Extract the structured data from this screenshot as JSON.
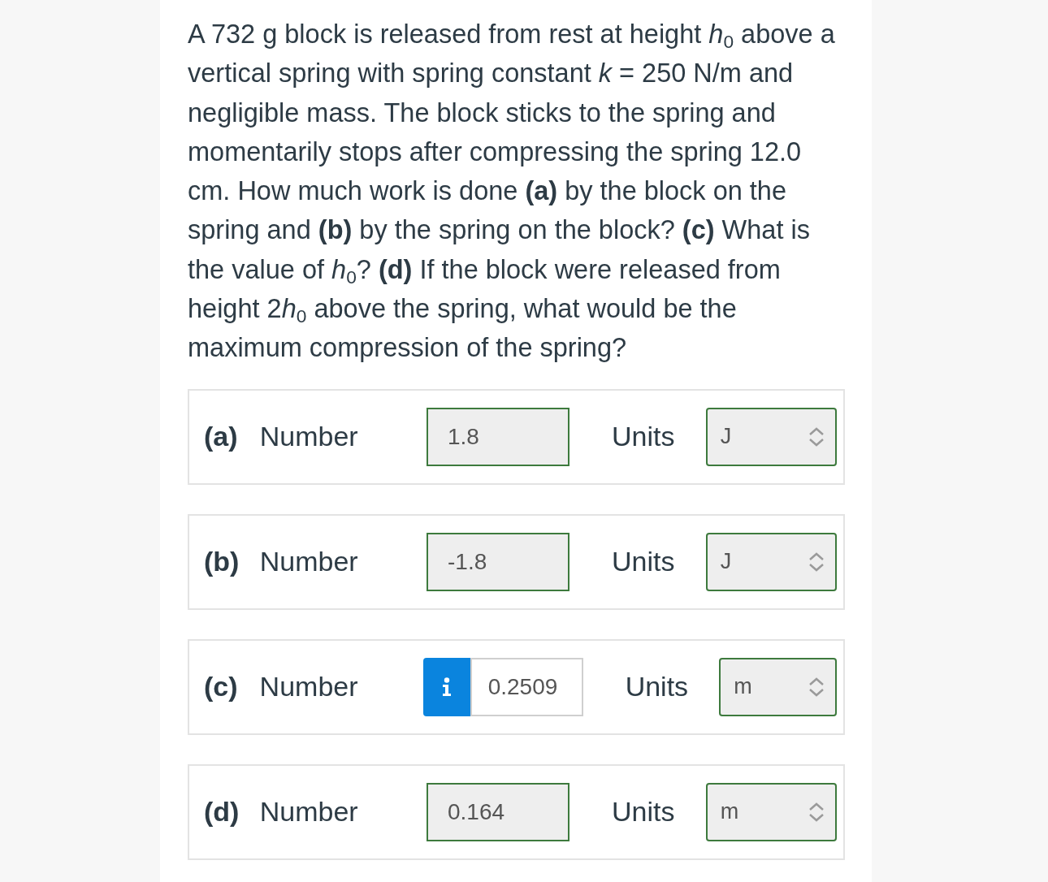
{
  "question": {
    "text_runs": [
      "A 732 g block is released from rest at height *h*$_{0}$ above a vertical spring with spring constant *k* = 250 N/m and negligible mass. The block sticks to the spring and momentarily stops after compressing the spring 12.0 cm. How much work is done **(a)** by the block on the spring and **(b)** by the spring on the block? **(c)** What is the value of *h*$_{0}$? **(d)** If the block were released from height 2",
      "*h*$_{0}$ above the spring, what would be the maximum compression of the spring?"
    ]
  },
  "answers": [
    {
      "part": "(a)",
      "number_label": "Number",
      "value": "1.8",
      "correct": true,
      "units_label": "Units",
      "units": {
        "value": "J",
        "correct": true
      }
    },
    {
      "part": "(b)",
      "number_label": "Number",
      "value": "-1.8",
      "correct": true,
      "units_label": "Units",
      "units": {
        "value": "J",
        "correct": true
      }
    },
    {
      "part": "(c)",
      "number_label": "Number",
      "value": "0.2509",
      "correct": false,
      "units_label": "Units",
      "units": {
        "value": "m",
        "correct": true
      }
    },
    {
      "part": "(d)",
      "number_label": "Number",
      "value": "0.164",
      "correct": true,
      "units_label": "Units",
      "units": {
        "value": "m",
        "correct": true
      }
    }
  ]
}
